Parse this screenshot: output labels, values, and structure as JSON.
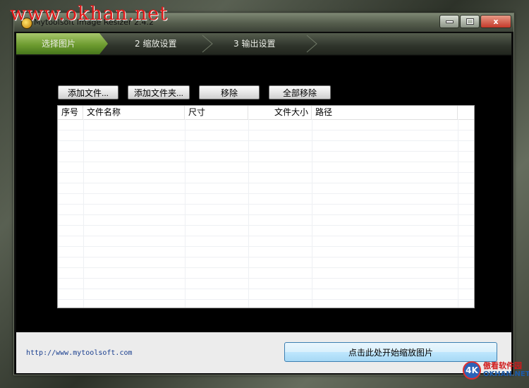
{
  "watermark": "www.okhan.net",
  "window": {
    "title": "Mytoolsoft Image Resizer 2.4.2",
    "controls": {
      "close_label": "x"
    }
  },
  "wizard": {
    "steps": [
      {
        "label": "选择图片",
        "active": true
      },
      {
        "label": "2  缩放设置",
        "active": false
      },
      {
        "label": "3  输出设置",
        "active": false
      }
    ]
  },
  "toolbar": {
    "add_file": "添加文件...",
    "add_folder": "添加文件夹...",
    "remove": "移除",
    "remove_all": "全部移除"
  },
  "file_table": {
    "columns": [
      {
        "label": "序号"
      },
      {
        "label": "文件名称"
      },
      {
        "label": "尺寸"
      },
      {
        "label": "文件大小"
      },
      {
        "label": "路径"
      }
    ],
    "rows": []
  },
  "footer": {
    "link": "http://www.mytoolsoft.com",
    "start_button": "点击此处开始缩放图片"
  },
  "logo": {
    "mark": "4K",
    "cn": "傲看软件园",
    "en": "OKHAN.NET"
  },
  "colors": {
    "active_step": "#6e9c30",
    "link": "#1a3f8f",
    "watermark": "#e01818"
  }
}
